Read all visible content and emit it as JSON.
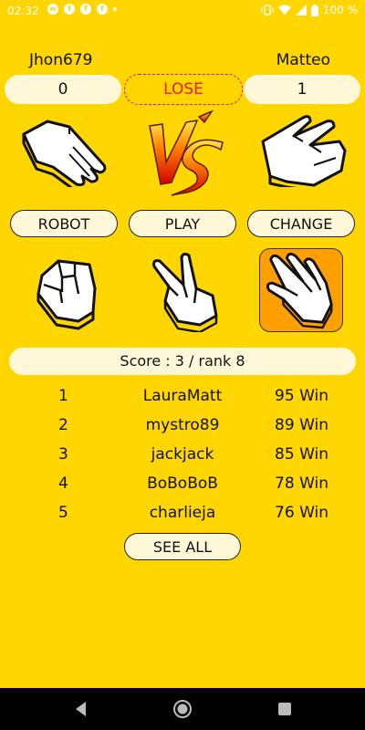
{
  "status_bar": {
    "time": "02:32",
    "battery": "100 %",
    "icons": [
      "whatsapp-icon",
      "facebook-icon",
      "facebook-icon",
      "facebook-icon",
      "dot-icon",
      "vibrate-icon",
      "wifi-icon",
      "signal-icon",
      "battery-icon"
    ]
  },
  "game": {
    "player_left": "Jhon679",
    "player_right": "Matteo",
    "score_left": "0",
    "score_right": "1",
    "result": "LOSE",
    "left_hand": "paper-hand-icon",
    "right_hand": "scissors-hand-icon",
    "vs_label": "VS"
  },
  "buttons": {
    "robot": "ROBOT",
    "play": "PLAY",
    "change": "CHANGE"
  },
  "choices": [
    {
      "name": "rock",
      "selected": false
    },
    {
      "name": "scissors",
      "selected": false
    },
    {
      "name": "paper",
      "selected": true
    }
  ],
  "score_summary": "Score : 3 / rank 8",
  "leaderboard": [
    {
      "rank": "1",
      "name": "LauraMatt",
      "wins": "95 Win"
    },
    {
      "rank": "2",
      "name": "mystro89",
      "wins": "89 Win"
    },
    {
      "rank": "3",
      "name": "jackjack",
      "wins": "85 Win"
    },
    {
      "rank": "4",
      "name": "BoBoBoB",
      "wins": "78 Win"
    },
    {
      "rank": "5",
      "name": "charlieja",
      "wins": "76 Win"
    }
  ],
  "see_all": "SEE ALL",
  "colors": {
    "background": "#FFD600",
    "pill": "#FFF8D8",
    "lose": "#E61B1B",
    "selected": "#FFA000"
  }
}
